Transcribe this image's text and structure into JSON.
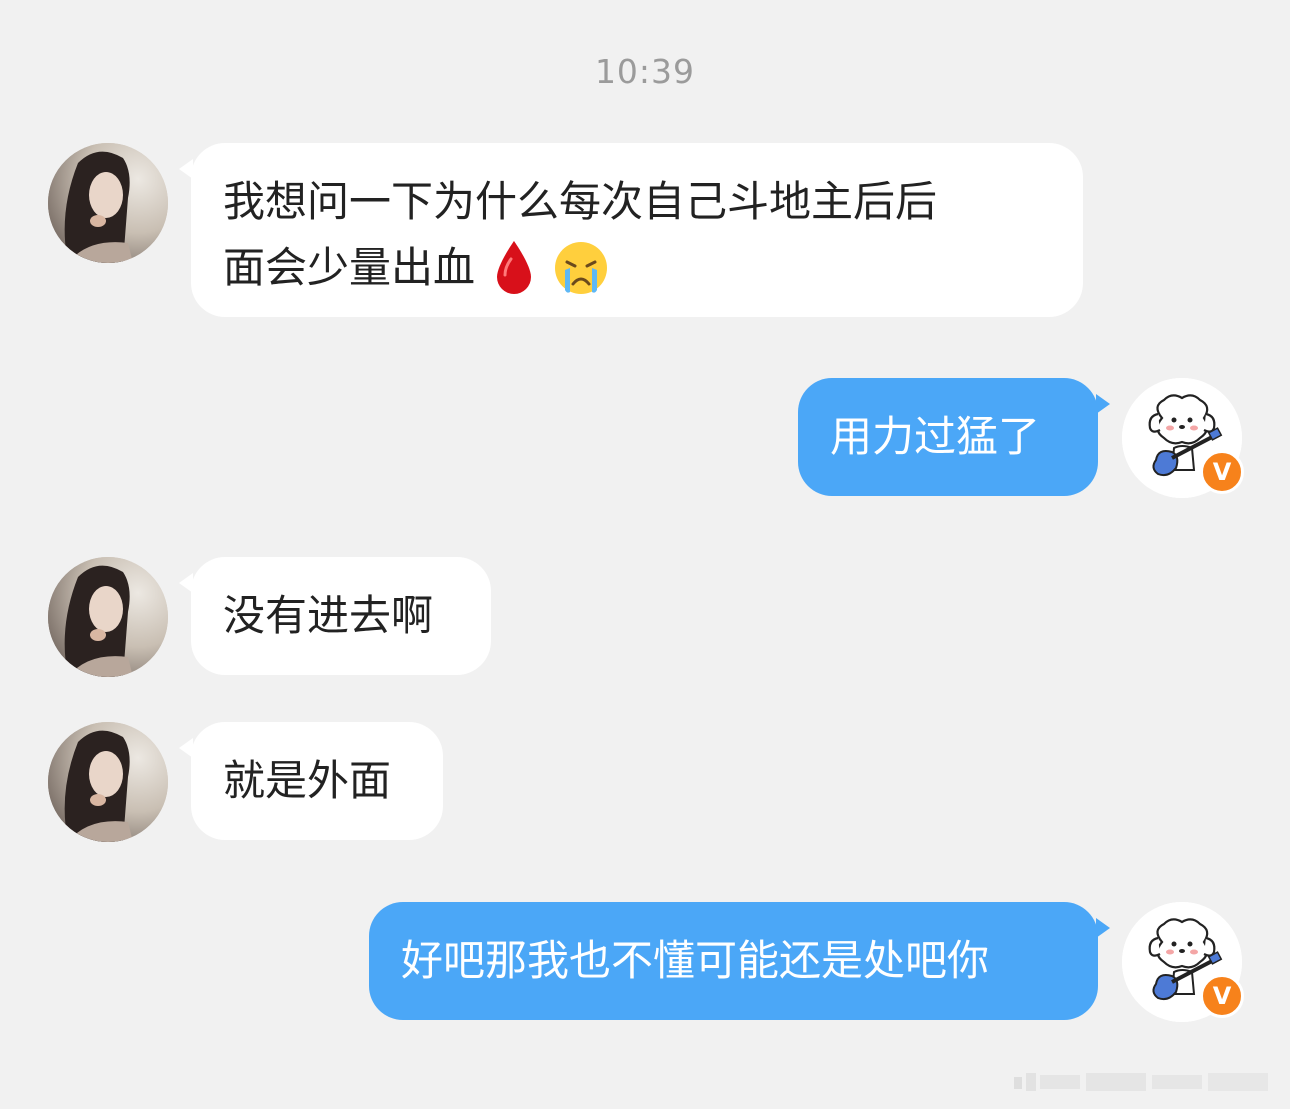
{
  "timestamp": "10:39",
  "messages": [
    {
      "side": "in",
      "text_line1": "我想问一下为什么每次自己斗地主后后",
      "text_line2": "面会少量出血",
      "emojis": [
        "blood-drop-icon",
        "crying-face-icon"
      ]
    },
    {
      "side": "out",
      "text": "用力过猛了"
    },
    {
      "side": "in",
      "text": "没有进去啊"
    },
    {
      "side": "in",
      "text": "就是外面"
    },
    {
      "side": "out",
      "text": "好吧那我也不懂可能还是处吧你"
    }
  ],
  "badge": {
    "label": "V",
    "color": "#f7821b"
  },
  "colors": {
    "background": "#f1f1f1",
    "incoming_bubble": "#ffffff",
    "outgoing_bubble": "#4ba7f7",
    "timestamp": "#9b9b9b"
  }
}
